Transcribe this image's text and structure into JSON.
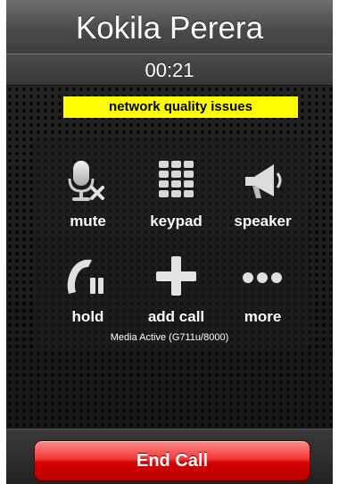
{
  "call": {
    "contact_name": "Kokila Perera",
    "duration": "00:21",
    "warning": "network quality issues",
    "media_status": "Media Active (G711u/8000)"
  },
  "controls": {
    "mute": {
      "label": "mute",
      "icon": "microphone-muted-icon"
    },
    "keypad": {
      "label": "keypad",
      "icon": "keypad-icon"
    },
    "speaker": {
      "label": "speaker",
      "icon": "speaker-icon"
    },
    "hold": {
      "label": "hold",
      "icon": "phone-hold-icon"
    },
    "add_call": {
      "label": "add call",
      "icon": "plus-icon"
    },
    "more": {
      "label": "more",
      "icon": "ellipsis-icon"
    }
  },
  "end_call": {
    "label": "End Call",
    "color": "#d40000"
  },
  "colors": {
    "warning_bg": "#ffff00",
    "background": "#1a1a1a"
  }
}
